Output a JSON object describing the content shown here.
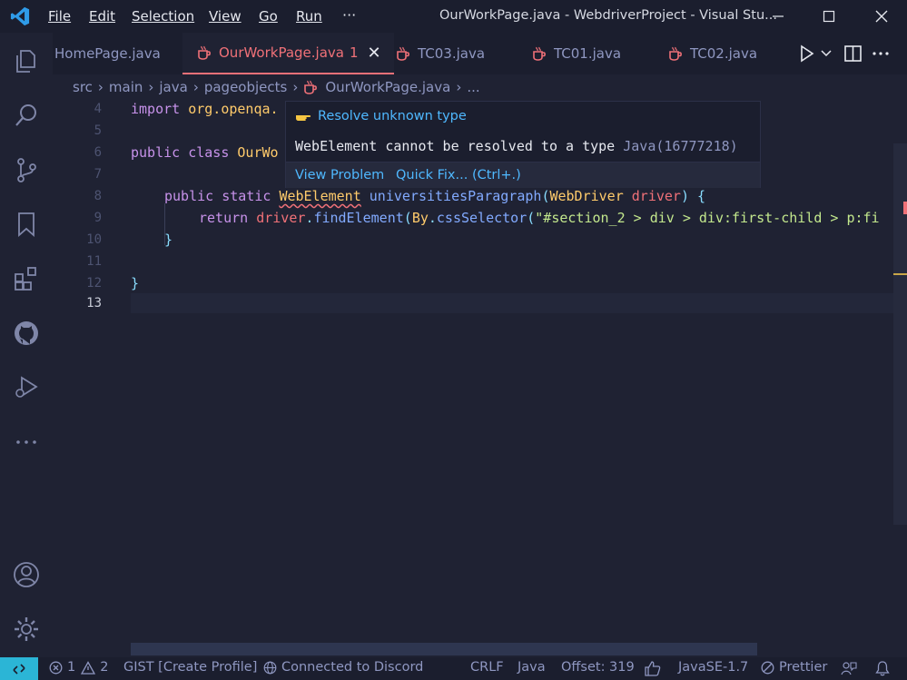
{
  "titlebar": {
    "menu": [
      {
        "label": "File"
      },
      {
        "label": "Edit"
      },
      {
        "label": "Selection"
      },
      {
        "label": "View"
      },
      {
        "label": "Go"
      },
      {
        "label": "Run"
      }
    ],
    "overflow": "···",
    "window_title": "OurWorkPage.java - WebdriverProject - Visual Stu..."
  },
  "tabs": [
    {
      "label": "HomePage.java",
      "active": false
    },
    {
      "label": "OurWorkPage.java",
      "active": true,
      "badge": "1"
    },
    {
      "label": "TC03.java",
      "active": false
    },
    {
      "label": "TC01.java",
      "active": false
    },
    {
      "label": "TC02.java",
      "active": false
    }
  ],
  "breadcrumb": [
    "src",
    "main",
    "java",
    "pageobjects",
    "OurWorkPage.java",
    "..."
  ],
  "editor": {
    "lines": [
      {
        "n": "4"
      },
      {
        "n": "5"
      },
      {
        "n": "6"
      },
      {
        "n": "7"
      },
      {
        "n": "8"
      },
      {
        "n": "9"
      },
      {
        "n": "10"
      },
      {
        "n": "11"
      },
      {
        "n": "12"
      },
      {
        "n": "13"
      }
    ],
    "code": {
      "l4_kw": "import",
      "l4_rest": "org.openqa.",
      "l6_kw": "public class",
      "l6_name": "OurWo",
      "l8_kw": "public static",
      "l8_type": "WebElement",
      "l8_fn": "universitiesParagraph",
      "l8_open": "(",
      "l8_ptype": "WebDriver",
      "l8_param": "driver",
      "l8_close": ") {",
      "l9_kw": "return",
      "l9_obj": "driver",
      "l9_dot": ".",
      "l9_fn": "findElement",
      "l9_open": "(",
      "l9_cls": "By",
      "l9_dot2": ".",
      "l9_fn2": "cssSelector",
      "l9_paren": "(",
      "l9_str": "\"#section_2 > div > div:first-child > p:fi",
      "l10": "}",
      "l12": "}"
    }
  },
  "hover": {
    "title": "Resolve unknown type",
    "message": "WebElement cannot be resolved to a type",
    "source": "Java(16777218)",
    "view_problem": "View Problem",
    "quick_fix": "Quick Fix... (Ctrl+.)"
  },
  "statusbar": {
    "errors": "1",
    "warnings": "2",
    "gist": "GIST [Create Profile]",
    "discord": "Connected to Discord",
    "eol": "CRLF",
    "language": "Java",
    "offset": "Offset: 319",
    "java_version": "JavaSE-1.7",
    "prettier": "Prettier"
  },
  "colors": {
    "accent": "#2bb5d6",
    "error": "#f07178",
    "link": "#4fb8ff"
  }
}
